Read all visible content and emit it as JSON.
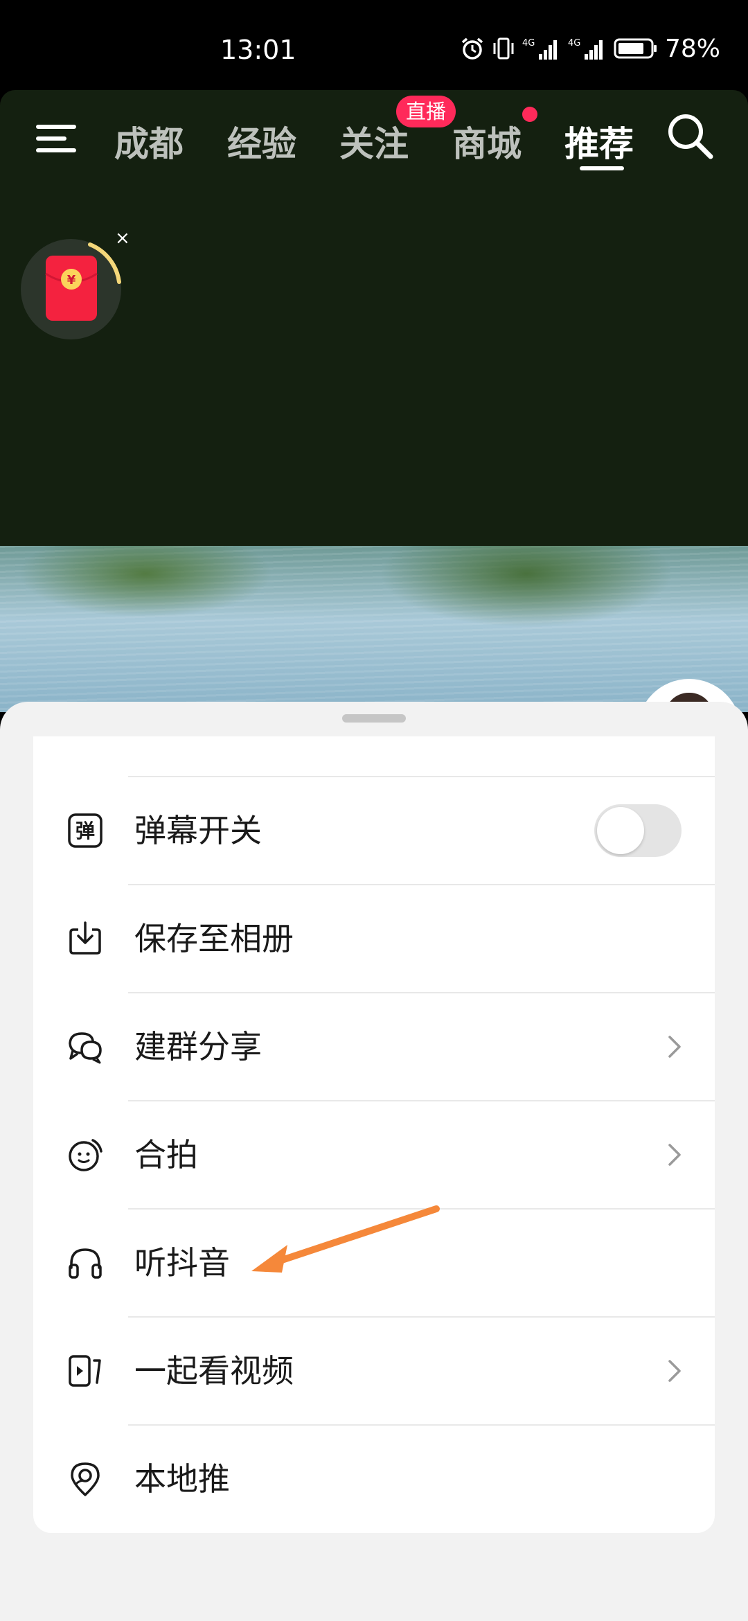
{
  "status_bar": {
    "time": "13:01",
    "network_1": "4G",
    "network_2": "4G",
    "battery": "78%"
  },
  "top_nav": {
    "menu_icon": "hamburger-menu-icon",
    "tabs": [
      {
        "label": "成都",
        "active": false
      },
      {
        "label": "经验",
        "active": false
      },
      {
        "label": "关注",
        "active": false,
        "badge": "直播"
      },
      {
        "label": "商城",
        "active": false,
        "dot": true
      },
      {
        "label": "推荐",
        "active": true
      }
    ],
    "search_icon": "search-icon"
  },
  "floating": {
    "red_packet_icon": "red-envelope-icon",
    "red_packet_symbol": "¥",
    "close_label": "×"
  },
  "sheet": {
    "items": [
      {
        "label": "弹幕开关",
        "icon": "danmaku-icon",
        "icon_text": "弹",
        "control": "toggle",
        "toggle_on": false
      },
      {
        "label": "保存至相册",
        "icon": "download-icon",
        "control": "none"
      },
      {
        "label": "建群分享",
        "icon": "chat-bubbles-icon",
        "control": "chevron"
      },
      {
        "label": "合拍",
        "icon": "duet-icon",
        "control": "chevron"
      },
      {
        "label": "听抖音",
        "icon": "headphones-icon",
        "control": "none"
      },
      {
        "label": "一起看视频",
        "icon": "watch-together-icon",
        "control": "chevron"
      },
      {
        "label": "本地推",
        "icon": "location-pin-icon",
        "control": "none"
      }
    ]
  },
  "annotation": {
    "arrow_color": "#f5883a",
    "points_to": "听抖音"
  },
  "colors": {
    "accent_red": "#ff2a5a",
    "sheet_bg": "#f2f2f2",
    "card_bg": "#ffffff"
  }
}
